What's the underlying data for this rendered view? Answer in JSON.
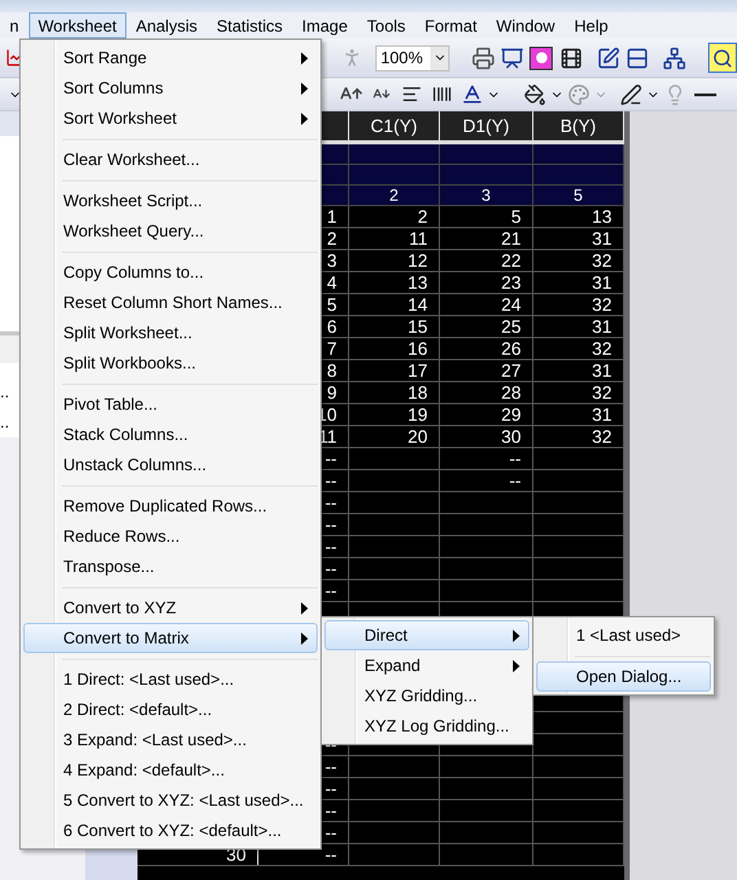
{
  "menubar": [
    {
      "label": "n",
      "selected": false
    },
    {
      "label": "Worksheet",
      "selected": true
    },
    {
      "label": "Analysis",
      "selected": false
    },
    {
      "label": "Statistics",
      "selected": false
    },
    {
      "label": "Image",
      "selected": false
    },
    {
      "label": "Tools",
      "selected": false
    },
    {
      "label": "Format",
      "selected": false
    },
    {
      "label": "Window",
      "selected": false
    },
    {
      "label": "Help",
      "selected": false
    }
  ],
  "toolbar": {
    "zoom": "100%"
  },
  "side_panel": {
    "items": [
      {
        "label": ".."
      },
      {
        "label": ".."
      }
    ]
  },
  "worksheet": {
    "columns": [
      "C1(Y)",
      "D1(Y)",
      "B(Y)"
    ],
    "parameter_row": [
      "2",
      "3",
      "5"
    ],
    "rows": [
      {
        "column_1": "1",
        "c1": "2",
        "d1": "5",
        "b": "13"
      },
      {
        "column_1": "2",
        "c1": "11",
        "d1": "21",
        "b": "31"
      },
      {
        "column_1": "3",
        "c1": "12",
        "d1": "22",
        "b": "32"
      },
      {
        "column_1": "4",
        "c1": "13",
        "d1": "23",
        "b": "31"
      },
      {
        "column_1": "5",
        "c1": "14",
        "d1": "24",
        "b": "32"
      },
      {
        "column_1": "6",
        "c1": "15",
        "d1": "25",
        "b": "31"
      },
      {
        "column_1": "7",
        "c1": "16",
        "d1": "26",
        "b": "32"
      },
      {
        "column_1": "8",
        "c1": "17",
        "d1": "27",
        "b": "31"
      },
      {
        "column_1": "9",
        "c1": "18",
        "d1": "28",
        "b": "32"
      },
      {
        "column_1": "10",
        "c1": "19",
        "d1": "29",
        "b": "31"
      },
      {
        "column_1": "11",
        "c1": "20",
        "d1": "30",
        "b": "32"
      },
      {
        "column_1": "--",
        "d1": "--"
      },
      {
        "column_1": "--",
        "d1": "--"
      },
      {
        "column_1": "--"
      },
      {
        "column_1": "--"
      },
      {
        "column_1": "--"
      },
      {
        "column_1": "--"
      },
      {
        "column_1": "--"
      },
      {},
      {},
      {},
      {},
      {},
      {},
      {
        "column_1": "--"
      },
      {
        "column_1": "--"
      },
      {
        "column_1": "--"
      },
      {
        "column_1": "--"
      },
      {
        "column_1": "--"
      },
      {
        "row_label": "30",
        "column_1": "--"
      }
    ]
  },
  "worksheet_menu": {
    "items": [
      {
        "kind": "item",
        "label": "Sort Range",
        "submenu": true,
        "selected": false
      },
      {
        "kind": "item",
        "label": "Sort Columns",
        "submenu": true,
        "selected": false
      },
      {
        "kind": "item",
        "label": "Sort Worksheet",
        "submenu": true,
        "selected": false
      },
      {
        "kind": "separator"
      },
      {
        "kind": "item",
        "label": "Clear Worksheet...",
        "submenu": false,
        "selected": false
      },
      {
        "kind": "separator"
      },
      {
        "kind": "item",
        "label": "Worksheet Script...",
        "submenu": false,
        "selected": false
      },
      {
        "kind": "item",
        "label": "Worksheet Query...",
        "submenu": false,
        "selected": false
      },
      {
        "kind": "separator"
      },
      {
        "kind": "item",
        "label": "Copy Columns to...",
        "submenu": false,
        "selected": false
      },
      {
        "kind": "item",
        "label": "Reset Column Short Names...",
        "submenu": false,
        "selected": false
      },
      {
        "kind": "item",
        "label": "Split Worksheet...",
        "submenu": false,
        "selected": false
      },
      {
        "kind": "item",
        "label": "Split Workbooks...",
        "submenu": false,
        "selected": false
      },
      {
        "kind": "separator"
      },
      {
        "kind": "item",
        "label": "Pivot Table...",
        "submenu": false,
        "selected": false
      },
      {
        "kind": "item",
        "label": "Stack Columns...",
        "submenu": false,
        "selected": false
      },
      {
        "kind": "item",
        "label": "Unstack Columns...",
        "submenu": false,
        "selected": false
      },
      {
        "kind": "separator"
      },
      {
        "kind": "item",
        "label": "Remove Duplicated Rows...",
        "submenu": false,
        "selected": false
      },
      {
        "kind": "item",
        "label": "Reduce Rows...",
        "submenu": false,
        "selected": false
      },
      {
        "kind": "item",
        "label": "Transpose...",
        "submenu": false,
        "selected": false
      },
      {
        "kind": "separator"
      },
      {
        "kind": "item",
        "label": "Convert to XYZ",
        "submenu": true,
        "selected": false
      },
      {
        "kind": "item",
        "label": "Convert to Matrix",
        "submenu": true,
        "selected": true
      },
      {
        "kind": "separator"
      },
      {
        "kind": "item",
        "label": "1 Direct: <Last used>...",
        "submenu": false,
        "selected": false
      },
      {
        "kind": "item",
        "label": "2 Direct: <default>...",
        "submenu": false,
        "selected": false
      },
      {
        "kind": "item",
        "label": "3 Expand: <Last used>...",
        "submenu": false,
        "selected": false
      },
      {
        "kind": "item",
        "label": "4 Expand: <default>...",
        "submenu": false,
        "selected": false
      },
      {
        "kind": "item",
        "label": "5 Convert to XYZ: <Last used>...",
        "submenu": false,
        "selected": false
      },
      {
        "kind": "item",
        "label": "6 Convert to XYZ: <default>...",
        "submenu": false,
        "selected": false
      }
    ]
  },
  "convert_to_matrix_menu": {
    "items": [
      {
        "kind": "item",
        "label": "Direct",
        "submenu": true,
        "selected": true
      },
      {
        "kind": "item",
        "label": "Expand",
        "submenu": true,
        "selected": false
      },
      {
        "kind": "item",
        "label": "XYZ Gridding...",
        "submenu": false,
        "selected": false
      },
      {
        "kind": "item",
        "label": "XYZ Log Gridding...",
        "submenu": false,
        "selected": false
      }
    ]
  },
  "direct_menu": {
    "items": [
      {
        "kind": "item",
        "label": "1 <Last used>",
        "submenu": false,
        "selected": false
      },
      {
        "kind": "separator"
      },
      {
        "kind": "item",
        "label": "Open Dialog...",
        "submenu": false,
        "selected": true
      }
    ]
  }
}
